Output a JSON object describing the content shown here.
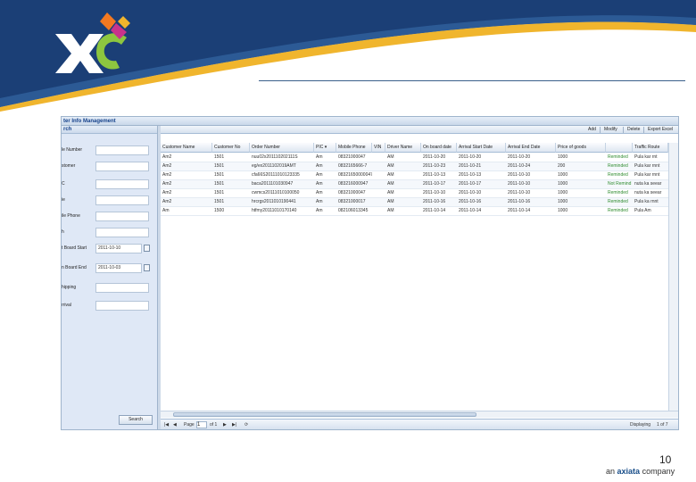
{
  "app_title": "ter Info Management",
  "search_panel": {
    "title": "rch",
    "fields": [
      {
        "label": "le Number",
        "value": ""
      },
      {
        "label": "stomer",
        "value": ""
      },
      {
        "label": "C",
        "value": ""
      },
      {
        "label": "ie",
        "value": ""
      },
      {
        "label": "ile Phone",
        "value": ""
      },
      {
        "label": "h",
        "value": ""
      },
      {
        "label": "t Board Start",
        "value": "2011-10-10"
      },
      {
        "label": "n Board End",
        "value": "2011-10-03"
      },
      {
        "label": "hipping",
        "value": ""
      },
      {
        "label": "rrival",
        "value": ""
      }
    ],
    "search_label": "Search"
  },
  "toolbar": {
    "add": "Add",
    "modify": "Modify",
    "delete": "Delete",
    "export": "Export Excel"
  },
  "grid": {
    "columns": [
      "Customer Name",
      "Customer No",
      "Order Number",
      "PIC",
      "Mobile Phone",
      "VIN",
      "Driver Name",
      "On board date",
      "Arrival Start Date",
      "Arrival End Date",
      "Price of goods",
      "",
      "Traffic Route"
    ],
    "rows": [
      [
        "Am2",
        "1501",
        "nuu02x201110202111S",
        "Am",
        "08321000047",
        "",
        "AM",
        "2011-10-20",
        "2011-10-20",
        "2011-10-20",
        "1000",
        "Reminded",
        "Pula kar rnt"
      ],
      [
        "Am2",
        "1501",
        "eg/ex2011102019AMT",
        "Am",
        "0832165666-7",
        "",
        "AM",
        "2011-10-23",
        "2011-10-21",
        "2011-10-24",
        "200",
        "Reminded",
        "Pula kar rnnt"
      ],
      [
        "Am2",
        "1501",
        "cfa66S20111010123335",
        "Am",
        "08321650000047",
        "",
        "AM",
        "2011-10-13",
        "2011-10-13",
        "2011-10-10",
        "1000",
        "Reminded",
        "Pula kar rnnt"
      ],
      [
        "Am2",
        "1501",
        "baca2011101030947",
        "Am",
        "083216000947",
        "",
        "AM",
        "2011-10-17",
        "2011-10-17",
        "2011-10-10",
        "1000",
        "Not Remind",
        "nuta ka seear"
      ],
      [
        "Am2",
        "1501",
        "cwmcs20111010100050",
        "Am",
        "08321000047",
        "",
        "AM",
        "2011-10-10",
        "2011-10-10",
        "2011-10-10",
        "1000",
        "Reminded",
        "nuta ka seear"
      ],
      [
        "Am2",
        "1501",
        "hrcrgs2011010190441",
        "Am",
        "08321000017",
        "",
        "AM",
        "2011-10-16",
        "2011-10-16",
        "2011-10-16",
        "1000",
        "Reminded",
        "Pula ka rnnt"
      ],
      [
        "Am",
        "1500",
        "htfmy20111010170140",
        "Am",
        "082106013345",
        "",
        "AM",
        "2011-10-14",
        "2011-10-14",
        "2011-10-14",
        "1000",
        "Reminded",
        "Pula Am"
      ]
    ]
  },
  "pager": {
    "page_label": "Page",
    "page_value": "1",
    "of_label": "of 1",
    "display_label": "Displaying",
    "display_of": "1 of 7"
  },
  "slide_number": "10",
  "footer": {
    "prefix": "an",
    "brand": "axiata",
    "suffix": "company"
  },
  "colors": {
    "header_blue": "#1b3f76",
    "header_gold": "#f0b52d",
    "logo_green": "#8dc63f",
    "logo_orange": "#f47920",
    "logo_magenta": "#c8338b",
    "status_green": "#2e8b2e"
  }
}
